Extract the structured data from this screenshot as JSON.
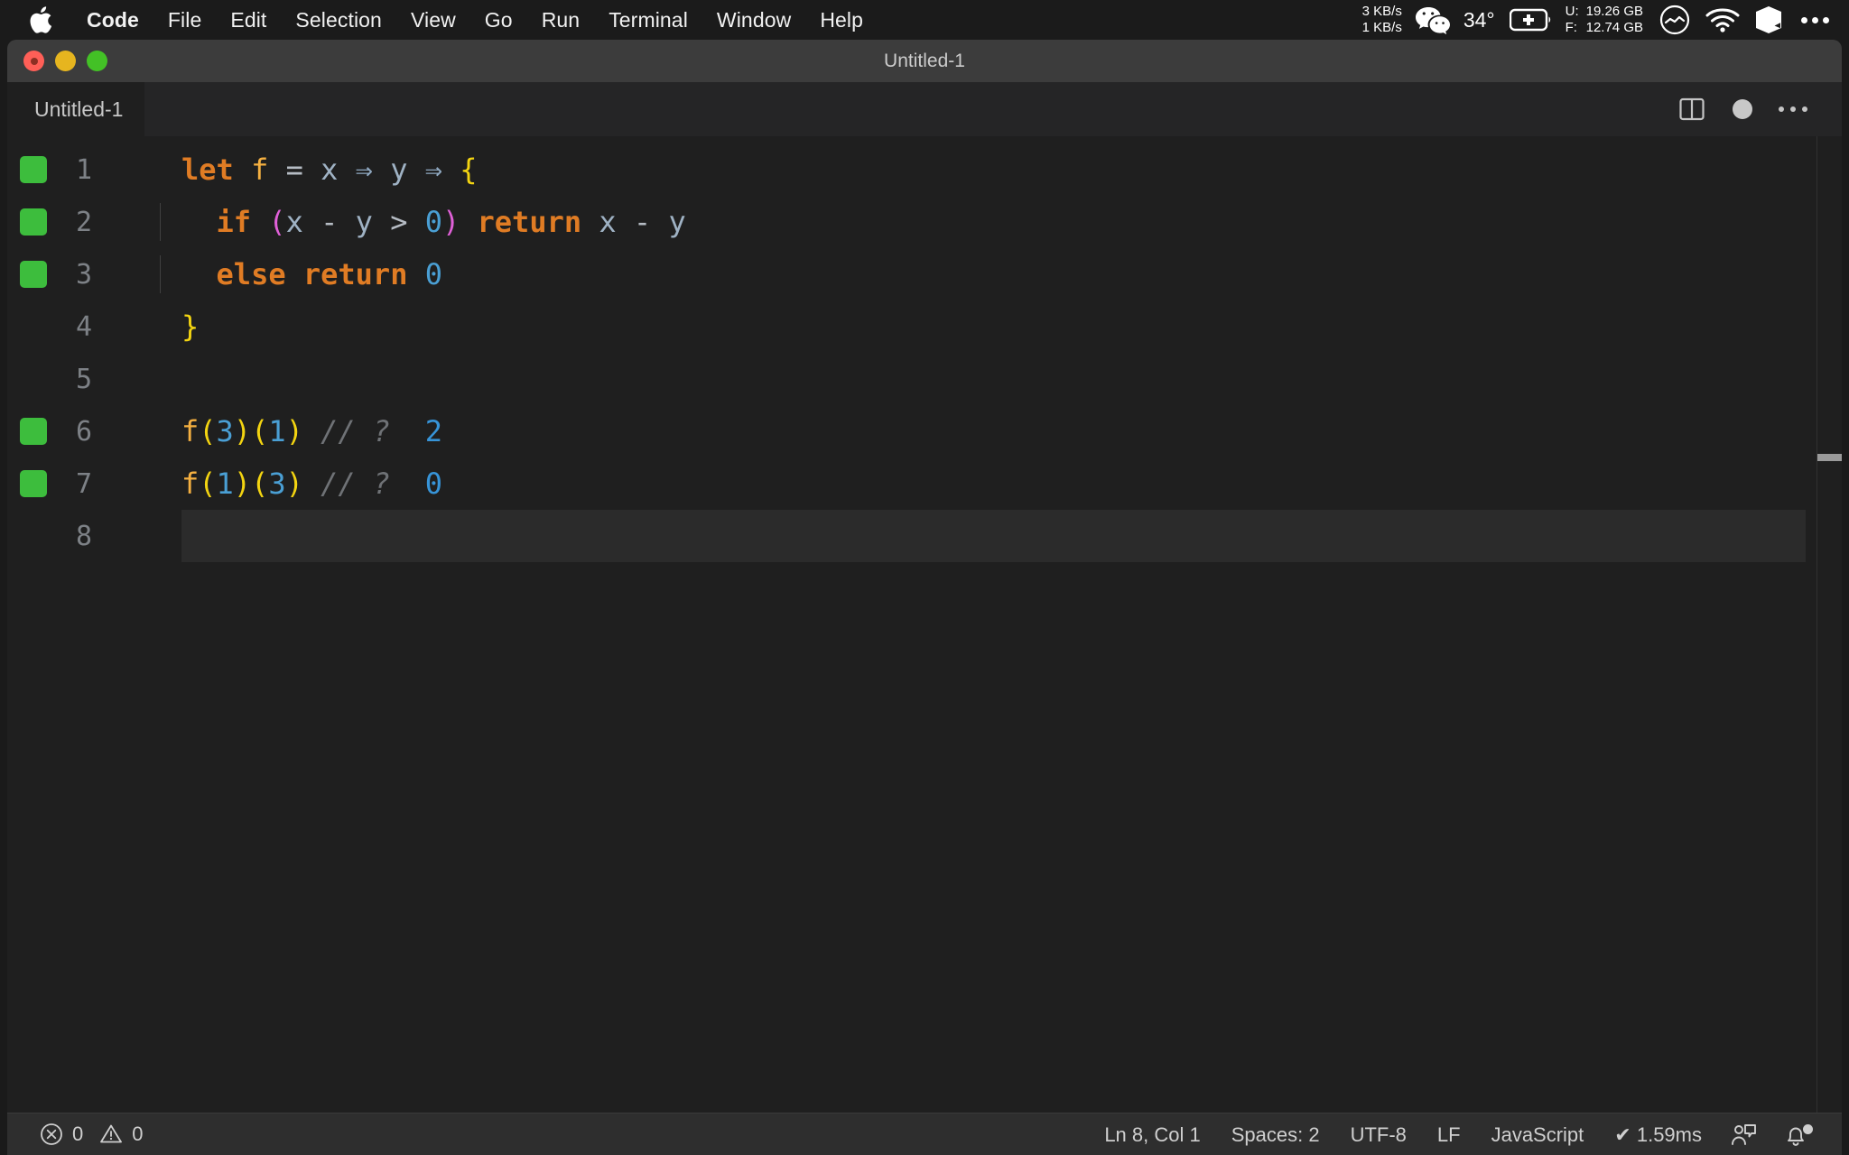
{
  "menubar": {
    "apple_icon": "apple-logo",
    "items": [
      {
        "label": "Code",
        "bold": true
      },
      {
        "label": "File",
        "bold": false
      },
      {
        "label": "Edit",
        "bold": false
      },
      {
        "label": "Selection",
        "bold": false
      },
      {
        "label": "View",
        "bold": false
      },
      {
        "label": "Go",
        "bold": false
      },
      {
        "label": "Run",
        "bold": false
      },
      {
        "label": "Terminal",
        "bold": false
      },
      {
        "label": "Window",
        "bold": false
      },
      {
        "label": "Help",
        "bold": false
      }
    ],
    "status": {
      "net_down": "3 KB/s",
      "net_up": "1 KB/s",
      "wechat_icon": "wechat-icon",
      "temperature": "34°",
      "battery_icon": "battery-charging-icon",
      "mem_used_label": "U:",
      "mem_used_value": "19.26 GB",
      "mem_free_label": "F:",
      "mem_free_value": "12.74 GB",
      "circle_icon": "stats-circle-icon",
      "wifi_icon": "wifi-icon",
      "cube_icon": "cube-icon",
      "control_center_icon": "control-center-dots-icon"
    }
  },
  "window": {
    "title": "Untitled-1",
    "traffic_lights": [
      "close",
      "minimize",
      "maximize"
    ]
  },
  "tabbar": {
    "tabs": [
      {
        "label": "Untitled-1",
        "active": true,
        "dirty": true
      }
    ],
    "actions": {
      "split_editor_icon": "split-editor-icon",
      "unsaved_dot_icon": "unsaved-dot-icon",
      "more_actions_icon": "more-actions-icon"
    }
  },
  "editor": {
    "language": "JavaScript",
    "current_line": 8,
    "lines": [
      {
        "number": "1",
        "coverage": true,
        "current": false,
        "indent_guide": false,
        "tokens": [
          {
            "t": "let",
            "c": "t-kw"
          },
          {
            "t": " ",
            "c": "t-op"
          },
          {
            "t": "f",
            "c": "t-fn"
          },
          {
            "t": " ",
            "c": "t-op"
          },
          {
            "t": "=",
            "c": "t-op"
          },
          {
            "t": " ",
            "c": "t-op"
          },
          {
            "t": "x",
            "c": "t-var"
          },
          {
            "t": " ",
            "c": "t-op"
          },
          {
            "t": "⇒",
            "c": "t-arrow"
          },
          {
            "t": " ",
            "c": "t-op"
          },
          {
            "t": "y",
            "c": "t-var"
          },
          {
            "t": " ",
            "c": "t-op"
          },
          {
            "t": "⇒",
            "c": "t-arrow"
          },
          {
            "t": " ",
            "c": "t-op"
          },
          {
            "t": "{",
            "c": "t-brace"
          }
        ]
      },
      {
        "number": "2",
        "coverage": true,
        "current": false,
        "indent_guide": true,
        "tokens": [
          {
            "t": "  ",
            "c": "t-op"
          },
          {
            "t": "if",
            "c": "t-kw"
          },
          {
            "t": " ",
            "c": "t-op"
          },
          {
            "t": "(",
            "c": "t-paren-m"
          },
          {
            "t": "x",
            "c": "t-var"
          },
          {
            "t": " ",
            "c": "t-op"
          },
          {
            "t": "-",
            "c": "t-op"
          },
          {
            "t": " ",
            "c": "t-op"
          },
          {
            "t": "y",
            "c": "t-var"
          },
          {
            "t": " ",
            "c": "t-op"
          },
          {
            "t": ">",
            "c": "t-op"
          },
          {
            "t": " ",
            "c": "t-op"
          },
          {
            "t": "0",
            "c": "t-num"
          },
          {
            "t": ")",
            "c": "t-paren-m"
          },
          {
            "t": " ",
            "c": "t-op"
          },
          {
            "t": "return",
            "c": "t-kw"
          },
          {
            "t": " ",
            "c": "t-op"
          },
          {
            "t": "x",
            "c": "t-var"
          },
          {
            "t": " ",
            "c": "t-op"
          },
          {
            "t": "-",
            "c": "t-op"
          },
          {
            "t": " ",
            "c": "t-op"
          },
          {
            "t": "y",
            "c": "t-var"
          }
        ]
      },
      {
        "number": "3",
        "coverage": true,
        "current": false,
        "indent_guide": true,
        "tokens": [
          {
            "t": "  ",
            "c": "t-op"
          },
          {
            "t": "else",
            "c": "t-kw"
          },
          {
            "t": " ",
            "c": "t-op"
          },
          {
            "t": "return",
            "c": "t-kw"
          },
          {
            "t": " ",
            "c": "t-op"
          },
          {
            "t": "0",
            "c": "t-num"
          }
        ]
      },
      {
        "number": "4",
        "coverage": false,
        "current": false,
        "indent_guide": false,
        "tokens": [
          {
            "t": "}",
            "c": "t-brace"
          }
        ]
      },
      {
        "number": "5",
        "coverage": false,
        "current": false,
        "indent_guide": false,
        "tokens": []
      },
      {
        "number": "6",
        "coverage": true,
        "current": false,
        "indent_guide": false,
        "tokens": [
          {
            "t": "f",
            "c": "t-fn"
          },
          {
            "t": "(",
            "c": "t-paren-y"
          },
          {
            "t": "3",
            "c": "t-num"
          },
          {
            "t": ")",
            "c": "t-paren-y"
          },
          {
            "t": "(",
            "c": "t-paren-y"
          },
          {
            "t": "1",
            "c": "t-num"
          },
          {
            "t": ")",
            "c": "t-paren-y"
          },
          {
            "t": " ",
            "c": "t-op"
          },
          {
            "t": "// ?",
            "c": "t-cmt"
          },
          {
            "t": "  ",
            "c": "t-op"
          },
          {
            "t": "2",
            "c": "t-numhi"
          }
        ]
      },
      {
        "number": "7",
        "coverage": true,
        "current": false,
        "indent_guide": false,
        "tokens": [
          {
            "t": "f",
            "c": "t-fn"
          },
          {
            "t": "(",
            "c": "t-paren-y"
          },
          {
            "t": "1",
            "c": "t-num"
          },
          {
            "t": ")",
            "c": "t-paren-y"
          },
          {
            "t": "(",
            "c": "t-paren-y"
          },
          {
            "t": "3",
            "c": "t-num"
          },
          {
            "t": ")",
            "c": "t-paren-y"
          },
          {
            "t": " ",
            "c": "t-op"
          },
          {
            "t": "// ?",
            "c": "t-cmt"
          },
          {
            "t": "  ",
            "c": "t-op"
          },
          {
            "t": "0",
            "c": "t-numhi"
          }
        ]
      },
      {
        "number": "8",
        "coverage": false,
        "current": true,
        "indent_guide": false,
        "tokens": []
      }
    ]
  },
  "statusbar": {
    "error_icon": "error-circle-icon",
    "error_count": "0",
    "warning_icon": "warning-triangle-icon",
    "warning_count": "0",
    "cursor_position": "Ln 8, Col 1",
    "indentation": "Spaces: 2",
    "encoding": "UTF-8",
    "eol": "LF",
    "language": "JavaScript",
    "run_status": "✔ 1.59ms",
    "feedback_icon": "feedback-person-icon",
    "bell_icon": "notifications-bell-icon"
  },
  "colors": {
    "menubar_bg": "#1b1b1b",
    "titlebar_bg": "#3c3c3c",
    "tabbar_bg": "#252526",
    "editor_bg": "#1f1f1f",
    "statusbar_bg": "#2e2e2e",
    "coverage_green": "#3dbd3d",
    "keyword_orange": "#e07c24",
    "brace_yellow": "#f3d411",
    "paren_magenta": "#e060d8",
    "number_blue": "#4a9fd4",
    "comment_gray": "#6f7276"
  }
}
